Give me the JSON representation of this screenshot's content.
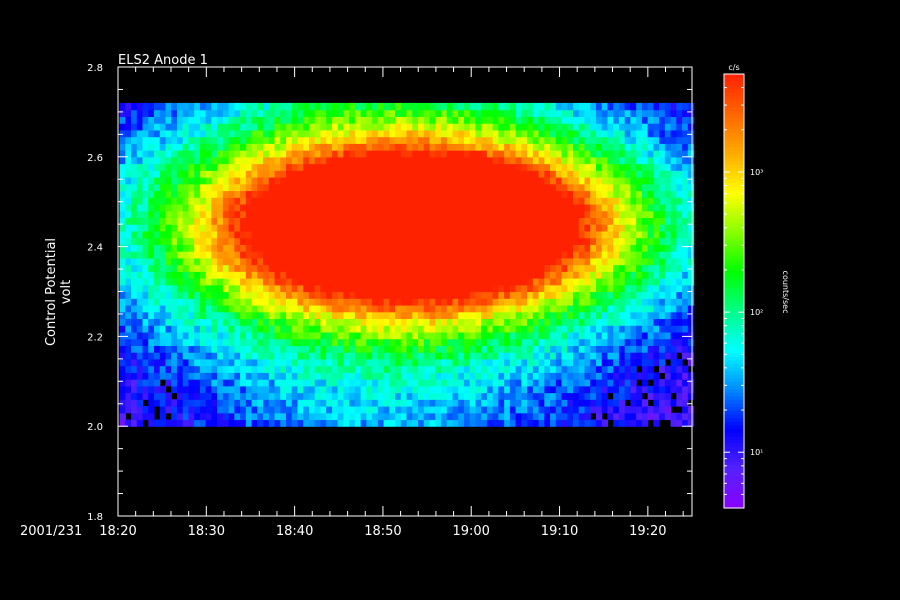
{
  "chart_data": {
    "type": "heatmap",
    "title": "ELS2 Anode 1",
    "date_label": "2001/231",
    "ylabel_line1": "Control Potential",
    "ylabel_line2": "volt",
    "xlim": [
      "18:20",
      "19:25"
    ],
    "x_ticks": [
      "18:20",
      "18:30",
      "18:40",
      "18:50",
      "19:00",
      "19:10",
      "19:20"
    ],
    "ylim": [
      1.8,
      2.8
    ],
    "y_ticks": [
      "1.8",
      "2.0",
      "2.2",
      "2.4",
      "2.6",
      "2.8"
    ],
    "data_y_range": [
      2.0,
      2.72
    ],
    "colorbar": {
      "unit": "c/s",
      "label": "counts/sec",
      "scale": "log",
      "range": [
        4,
        5000
      ],
      "ticks": [
        {
          "label": "10¹",
          "value": 10
        },
        {
          "label": "10²",
          "value": 100
        },
        {
          "label": "10³",
          "value": 1000
        }
      ]
    },
    "peak": {
      "time": "18:54",
      "potential": 2.44,
      "counts": 4000
    },
    "colors": [
      "#8800ff",
      "#5522ff",
      "#0000ff",
      "#0088ff",
      "#00ffff",
      "#00ff88",
      "#00ff00",
      "#88ff00",
      "#ffff00",
      "#ffaa00",
      "#ff6600",
      "#ff2200"
    ]
  }
}
